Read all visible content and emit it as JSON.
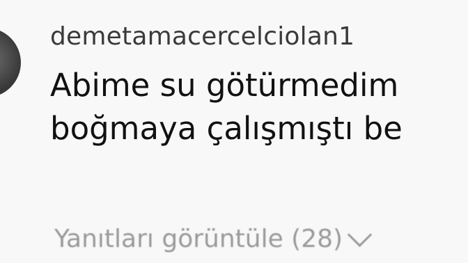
{
  "comment": {
    "username": "demetamacercelciolan1",
    "lines": [
      "Abime su götürmedim",
      "boğmaya çalışmıştı be"
    ]
  },
  "replies": {
    "label": "Yanıtları görüntüle (28)",
    "icon": "chevron-down-icon"
  },
  "colors": {
    "username": "#3a3a3a",
    "text": "#111111",
    "muted": "#9a9a9a",
    "background": "#f8f8f8"
  }
}
